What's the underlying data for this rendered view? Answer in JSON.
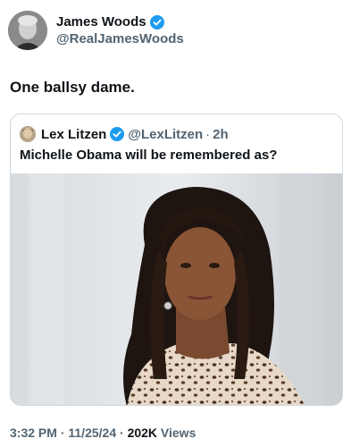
{
  "author": {
    "name": "James Woods",
    "handle": "@RealJamesWoods",
    "verified": true
  },
  "tweet": {
    "text": "One ballsy dame."
  },
  "quoted_tweet": {
    "name": "Lex Litzen",
    "handle": "@LexLitzen",
    "separator": "·",
    "time": "2h",
    "verified": true,
    "text": "Michelle Obama will be remembered as?"
  },
  "meta": {
    "time": "3:32 PM",
    "date": "11/25/24",
    "views_count": "202K",
    "views_label": "Views",
    "separator": "·"
  },
  "colors": {
    "verified_badge": "#1d9bf0",
    "secondary_text": "#536471",
    "border": "#cfd9de"
  }
}
